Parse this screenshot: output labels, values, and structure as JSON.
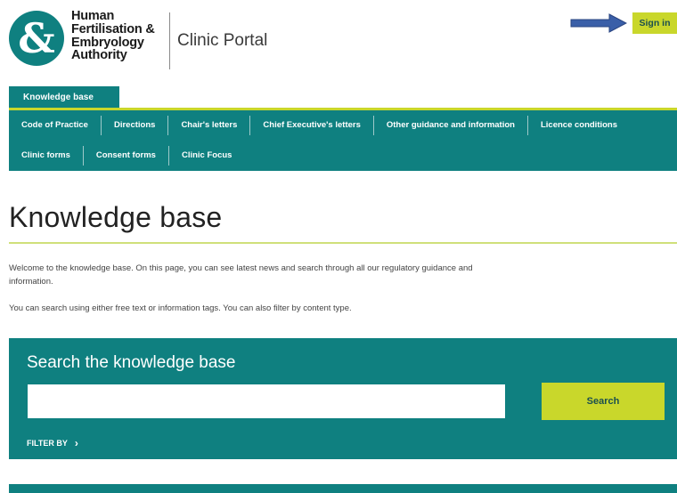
{
  "header": {
    "logo_glyph": "&",
    "org_name_lines": [
      "Human",
      "Fertilisation &",
      "Embryology",
      "Authority"
    ],
    "portal_name": "Clinic Portal",
    "sign_in_label": "Sign in"
  },
  "nav": {
    "active_tab": "Knowledge base",
    "row1": [
      "Code of Practice",
      "Directions",
      "Chair's letters",
      "Chief Executive's letters",
      "Other guidance and information",
      "Licence conditions"
    ],
    "row2": [
      "Clinic forms",
      "Consent forms",
      "Clinic Focus"
    ]
  },
  "main": {
    "title": "Knowledge base",
    "intro_p1": "Welcome to the knowledge base. On this page, you can see latest news and search through all our regulatory guidance and information.",
    "intro_p2": "You can search using either free text or information tags. You can also filter by content type."
  },
  "search": {
    "heading": "Search the knowledge base",
    "input_value": "",
    "button_label": "Search",
    "filter_label": "FILTER BY",
    "filter_icon": "chevron-right-icon"
  },
  "colors": {
    "brand_teal": "#0f8080",
    "accent_lime": "#c9d72b",
    "annotation_arrow": "#3a5fa8"
  }
}
